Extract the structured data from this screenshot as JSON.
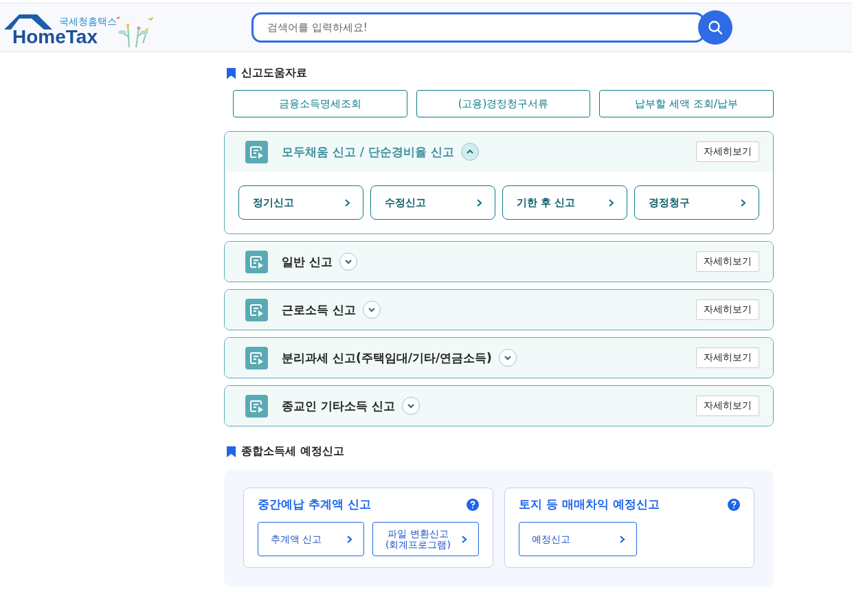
{
  "header": {
    "logo_subtitle": "국세청홈택스",
    "logo_title": "HomeTax",
    "search": {
      "placeholder": "검색어를 입력하세요!"
    }
  },
  "help_section": {
    "title": "신고도움자료",
    "links": [
      "금융소득명세조회",
      "(고용)경정청구서류",
      "납부할 세액 조회/납부"
    ]
  },
  "panels": [
    {
      "title": "모두채움 신고 / 단순경비율 신고",
      "expanded": true,
      "detail_button": "자세히보기",
      "actions": [
        "정기신고",
        "수정신고",
        "기한 후 신고",
        "경정청구"
      ]
    },
    {
      "title": "일반 신고",
      "expanded": false,
      "detail_button": "자세히보기"
    },
    {
      "title": "근로소득 신고",
      "expanded": false,
      "detail_button": "자세히보기"
    },
    {
      "title": "분리과세 신고(주택임대/기타/연금소득)",
      "expanded": false,
      "detail_button": "자세히보기"
    },
    {
      "title": "종교인 기타소득 신고",
      "expanded": false,
      "detail_button": "자세히보기"
    }
  ],
  "interim_section": {
    "title": "종합소득세 예정신고",
    "cards": [
      {
        "title": "중간예납 추계액 신고",
        "buttons": [
          [
            "추계액 신고"
          ],
          [
            "파일 변환신고",
            "(회계프로그램)"
          ]
        ]
      },
      {
        "title": "토지 등 매매차익 예정신고",
        "buttons": [
          [
            "예정신고"
          ]
        ]
      }
    ]
  }
}
